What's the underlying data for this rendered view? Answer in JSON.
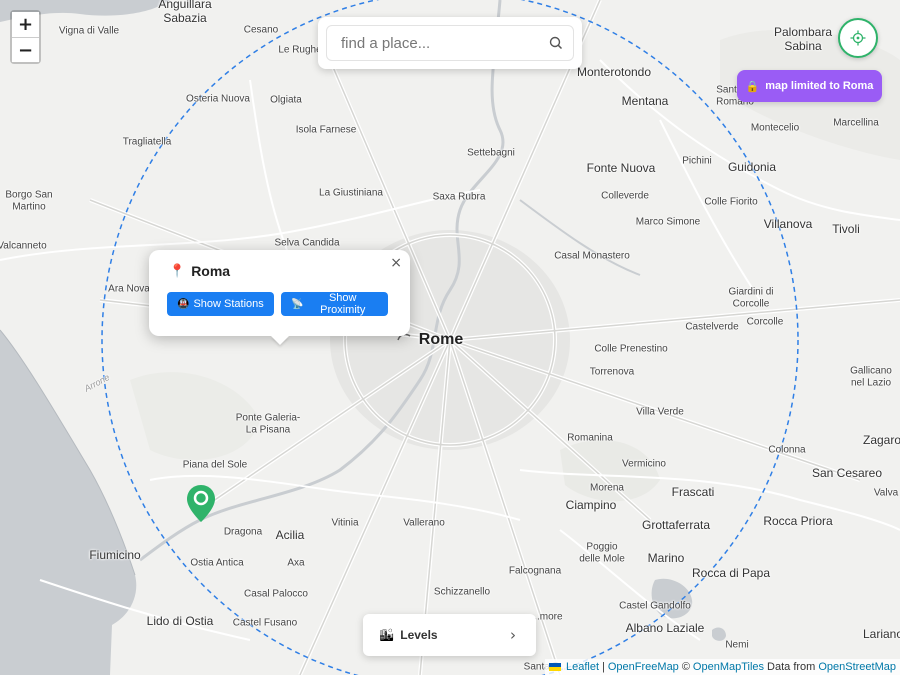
{
  "map": {
    "center_label": "Rome",
    "places": [
      {
        "name": "Anguillara\nSabazia",
        "cls": "mid"
      },
      {
        "name": "Vigna di Valle",
        "cls": "minor"
      },
      {
        "name": "Cesano",
        "cls": "minor"
      },
      {
        "name": "Le Rughe",
        "cls": "minor"
      },
      {
        "name": "Palombara\nSabina",
        "cls": "mid"
      },
      {
        "name": "Monterotondo",
        "cls": "mid"
      },
      {
        "name": "Mentana",
        "cls": "mid"
      },
      {
        "name": "Sant'A...\nRomano",
        "cls": "minor"
      },
      {
        "name": "Montecelio",
        "cls": "minor"
      },
      {
        "name": "Marcellina",
        "cls": "minor"
      },
      {
        "name": "Osteria Nuova",
        "cls": "minor"
      },
      {
        "name": "Olgiata",
        "cls": "minor"
      },
      {
        "name": "Isola Farnese",
        "cls": "minor"
      },
      {
        "name": "Tragliatella",
        "cls": "minor"
      },
      {
        "name": "Settebagni",
        "cls": "minor"
      },
      {
        "name": "Fonte Nuova",
        "cls": "mid"
      },
      {
        "name": "Pichini",
        "cls": "minor"
      },
      {
        "name": "Guidonia",
        "cls": "mid"
      },
      {
        "name": "Borgo San\nMartino",
        "cls": "minor"
      },
      {
        "name": "La Giustiniana",
        "cls": "minor"
      },
      {
        "name": "Saxa Rubra",
        "cls": "minor"
      },
      {
        "name": "Colleverde",
        "cls": "minor"
      },
      {
        "name": "Colle Fiorito",
        "cls": "minor"
      },
      {
        "name": "Marco Simone",
        "cls": "minor"
      },
      {
        "name": "Villanova",
        "cls": "mid"
      },
      {
        "name": "Tivoli",
        "cls": "mid"
      },
      {
        "name": "Valcanneto",
        "cls": "minor"
      },
      {
        "name": "Selva Candida",
        "cls": "minor"
      },
      {
        "name": "Casal Monastero",
        "cls": "minor"
      },
      {
        "name": "Ara Nova",
        "cls": "minor"
      },
      {
        "name": "Giardini di\nCorcolle",
        "cls": "minor"
      },
      {
        "name": "Castelverde",
        "cls": "minor"
      },
      {
        "name": "Corcolle",
        "cls": "minor"
      },
      {
        "name": "Colle Prenestino",
        "cls": "minor"
      },
      {
        "name": "Torrenova",
        "cls": "minor"
      },
      {
        "name": "Gallicano\nnel Lazio",
        "cls": "minor"
      },
      {
        "name": "Arrone",
        "cls": "road"
      },
      {
        "name": "Villa Verde",
        "cls": "minor"
      },
      {
        "name": "Ponte Galeria-\nLa Pisana",
        "cls": "minor"
      },
      {
        "name": "Romanina",
        "cls": "minor"
      },
      {
        "name": "Zagaro",
        "cls": "mid"
      },
      {
        "name": "Colonna",
        "cls": "minor"
      },
      {
        "name": "Piana del Sole",
        "cls": "minor"
      },
      {
        "name": "Vermicino",
        "cls": "minor"
      },
      {
        "name": "San Cesareo",
        "cls": "mid"
      },
      {
        "name": "Morena",
        "cls": "minor"
      },
      {
        "name": "Frascati",
        "cls": "mid"
      },
      {
        "name": "Valva",
        "cls": "minor"
      },
      {
        "name": "Ciampino",
        "cls": "mid"
      },
      {
        "name": "Dragona",
        "cls": "minor"
      },
      {
        "name": "Acilia",
        "cls": "mid"
      },
      {
        "name": "Vitinia",
        "cls": "minor"
      },
      {
        "name": "Vallerano",
        "cls": "minor"
      },
      {
        "name": "Grottaferrata",
        "cls": "mid"
      },
      {
        "name": "Rocca Priora",
        "cls": "mid"
      },
      {
        "name": "Fiumicino",
        "cls": "mid"
      },
      {
        "name": "Ostia Antica",
        "cls": "minor"
      },
      {
        "name": "Axa",
        "cls": "minor"
      },
      {
        "name": "Poggio\ndelle Mole",
        "cls": "minor"
      },
      {
        "name": "Marino",
        "cls": "mid"
      },
      {
        "name": "Falcognana",
        "cls": "minor"
      },
      {
        "name": "Rocca di Papa",
        "cls": "mid"
      },
      {
        "name": "Casal Palocco",
        "cls": "minor"
      },
      {
        "name": "Schizzanello",
        "cls": "minor"
      },
      {
        "name": "Castel Gandolfo",
        "cls": "minor"
      },
      {
        "name": "Lido di Ostia",
        "cls": "mid"
      },
      {
        "name": "Castel Fusano",
        "cls": "minor"
      },
      {
        "name": "Albano Laziale",
        "cls": "mid"
      },
      {
        "name": "Lariano",
        "cls": "mid"
      },
      {
        "name": "Nemi",
        "cls": "minor"
      },
      {
        "name": "...more",
        "cls": "minor"
      },
      {
        "name": "Santa P...",
        "cls": "minor"
      }
    ]
  },
  "zoom": {
    "in_label": "+",
    "out_label": "−"
  },
  "search": {
    "placeholder": "find a place..."
  },
  "limit_badge": {
    "label": "map limited to Roma",
    "icon": "lock-icon"
  },
  "popup": {
    "title": "Roma",
    "close_label": "×",
    "pin_icon": "📍",
    "buttons": [
      {
        "label": "Show Stations",
        "icon": "🚇"
      },
      {
        "label": "Show Proximity",
        "icon": "📡"
      }
    ]
  },
  "levels": {
    "label": "Levels",
    "icon": "🏙",
    "chevron": "›"
  },
  "attribution": {
    "leaflet": "Leaflet",
    "sep": "|",
    "openfreemap": "OpenFreeMap",
    "copyright": "©",
    "openmaptiles": "OpenMapTiles",
    "data_from": "Data from",
    "osm": "OpenStreetMap"
  },
  "colors": {
    "accent_blue": "#1a7ef2",
    "limit_purple": "#9a5cf5",
    "marker_green": "#2fb36a",
    "radius_circle": "#2f7fe6",
    "water": "#c9cdd1"
  }
}
